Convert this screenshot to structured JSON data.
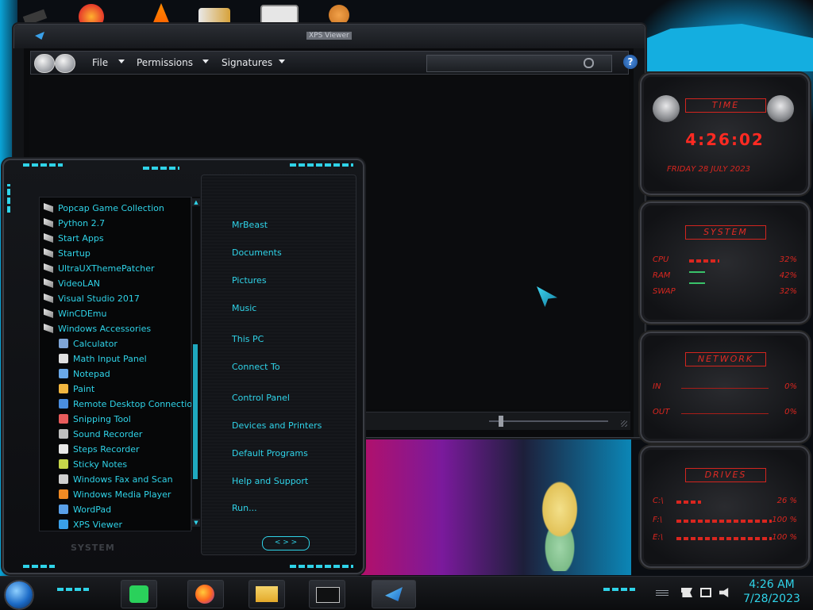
{
  "window": {
    "title": "XPS Viewer",
    "menu": [
      "File",
      "Permissions",
      "Signatures"
    ],
    "help_glyph": "?"
  },
  "gadgets": {
    "time": {
      "header": "TIME",
      "clock": "4:26:02",
      "date": "FRIDAY 28 JULY 2023"
    },
    "system": {
      "header": "SYSTEM",
      "rows": [
        {
          "label": "CPU",
          "value": "32%",
          "level": 0.32
        },
        {
          "label": "RAM",
          "value": "42%",
          "level": 0.42
        },
        {
          "label": "SWAP",
          "value": "32%",
          "level": 0.32
        }
      ]
    },
    "network": {
      "header": "NETWORK",
      "rows": [
        {
          "label": "IN",
          "value": "0%"
        },
        {
          "label": "OUT",
          "value": "0%"
        }
      ]
    },
    "drives": {
      "header": "DRIVES",
      "rows": [
        {
          "label": "C:\\",
          "value": "26 %",
          "level": 0.26
        },
        {
          "label": "F:\\",
          "value": "100 %",
          "level": 1.0
        },
        {
          "label": "E:\\",
          "value": "100 %",
          "level": 1.0
        }
      ]
    }
  },
  "start_menu": {
    "programs": [
      {
        "label": "Popcap Game Collection",
        "icon": "folder-icon",
        "indent": false
      },
      {
        "label": "Python 2.7",
        "icon": "folder-icon",
        "indent": false
      },
      {
        "label": "Start Apps",
        "icon": "folder-icon",
        "indent": false
      },
      {
        "label": "Startup",
        "icon": "folder-icon",
        "indent": false
      },
      {
        "label": "UltraUXThemePatcher",
        "icon": "folder-icon",
        "indent": false
      },
      {
        "label": "VideoLAN",
        "icon": "folder-icon",
        "indent": false
      },
      {
        "label": "Visual Studio 2017",
        "icon": "folder-icon",
        "indent": false
      },
      {
        "label": "WinCDEmu",
        "icon": "folder-icon",
        "indent": false
      },
      {
        "label": "Windows Accessories",
        "icon": "folder-icon",
        "indent": false
      },
      {
        "label": "Calculator",
        "icon": "calculator-icon",
        "indent": true
      },
      {
        "label": "Math Input Panel",
        "icon": "math-input-icon",
        "indent": true
      },
      {
        "label": "Notepad",
        "icon": "notepad-icon",
        "indent": true
      },
      {
        "label": "Paint",
        "icon": "paint-icon",
        "indent": true
      },
      {
        "label": "Remote Desktop Connection",
        "icon": "remote-desktop-icon",
        "indent": true
      },
      {
        "label": "Snipping Tool",
        "icon": "snipping-tool-icon",
        "indent": true
      },
      {
        "label": "Sound Recorder",
        "icon": "microphone-icon",
        "indent": true
      },
      {
        "label": "Steps Recorder",
        "icon": "steps-recorder-icon",
        "indent": true
      },
      {
        "label": "Sticky Notes",
        "icon": "sticky-notes-icon",
        "indent": true
      },
      {
        "label": "Windows Fax and Scan",
        "icon": "fax-icon",
        "indent": true
      },
      {
        "label": "Windows Media Player",
        "icon": "media-player-icon",
        "indent": true
      },
      {
        "label": "WordPad",
        "icon": "wordpad-icon",
        "indent": true
      },
      {
        "label": "XPS Viewer",
        "icon": "xps-viewer-icon",
        "indent": true
      }
    ],
    "places": [
      "MrBeast",
      "Documents",
      "Pictures",
      "Music",
      "This PC",
      "Connect To",
      "Control Panel",
      "Devices and Printers",
      "Default Programs",
      "Help and Support",
      "Run..."
    ],
    "footer_label": "SYSTEM",
    "nav_arrows": "< > >"
  },
  "taskbar": {
    "apps": [
      "spotify-icon",
      "firefox-icon",
      "file-explorer-icon",
      "command-prompt-icon",
      "xps-viewer-icon"
    ],
    "clock_time": "4:26 AM",
    "clock_date": "7/28/2023"
  },
  "colors": {
    "accent": "#2fd3e8",
    "gadget_red": "#d9261f"
  }
}
